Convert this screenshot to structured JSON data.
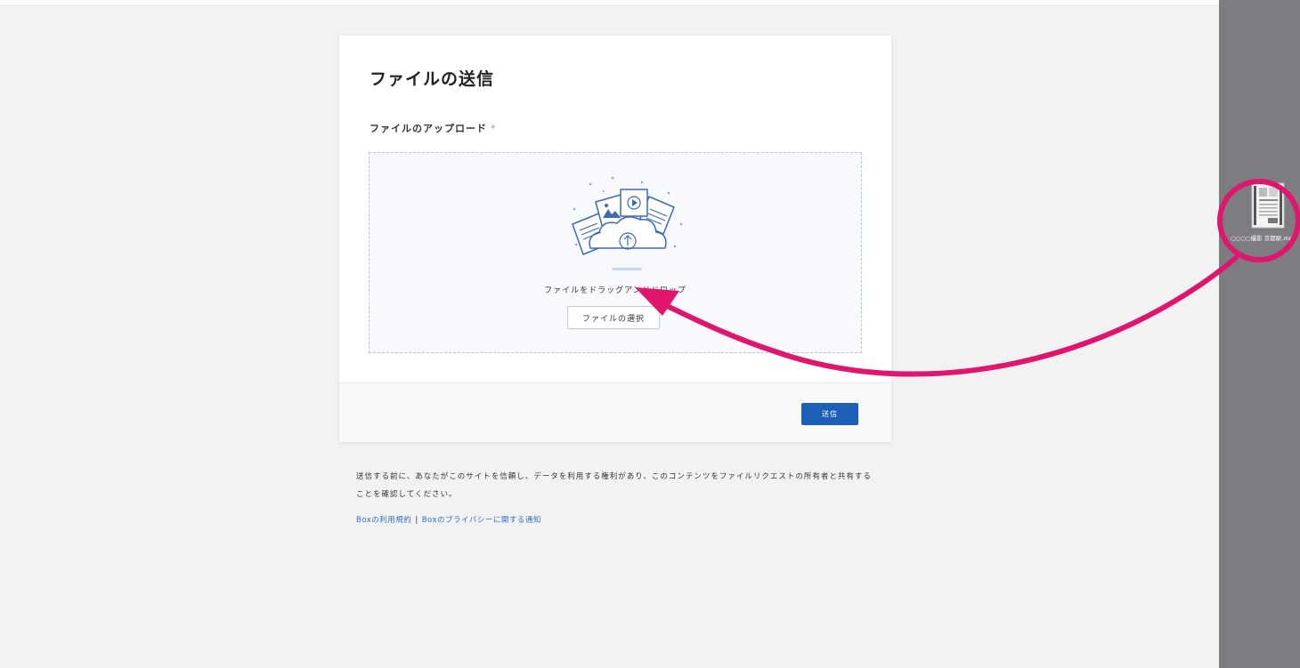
{
  "form": {
    "title": "ファイルの送信",
    "upload_label": "ファイルのアップロード",
    "required_mark": "*",
    "drop_text": "ファイルをドラッグアンドドロップ",
    "choose_button": "ファイルの選択",
    "send_button": "送信"
  },
  "disclaimer": {
    "text": "送信する前に、あなたがこのサイトを信頼し、データを利用する権利があり、このコンテンツをファイルリクエストの所有者と共有することを確認してください。"
  },
  "links": {
    "terms": "Boxの利用規約",
    "separator": "|",
    "privacy": "Boxのプライバシーに関する通知"
  },
  "desktop_file": {
    "name": "○○○○撮影 京都駅.mp4"
  },
  "colors": {
    "primary": "#1d5fb6",
    "annotation": "#e0156e",
    "link": "#2d6fc8"
  }
}
